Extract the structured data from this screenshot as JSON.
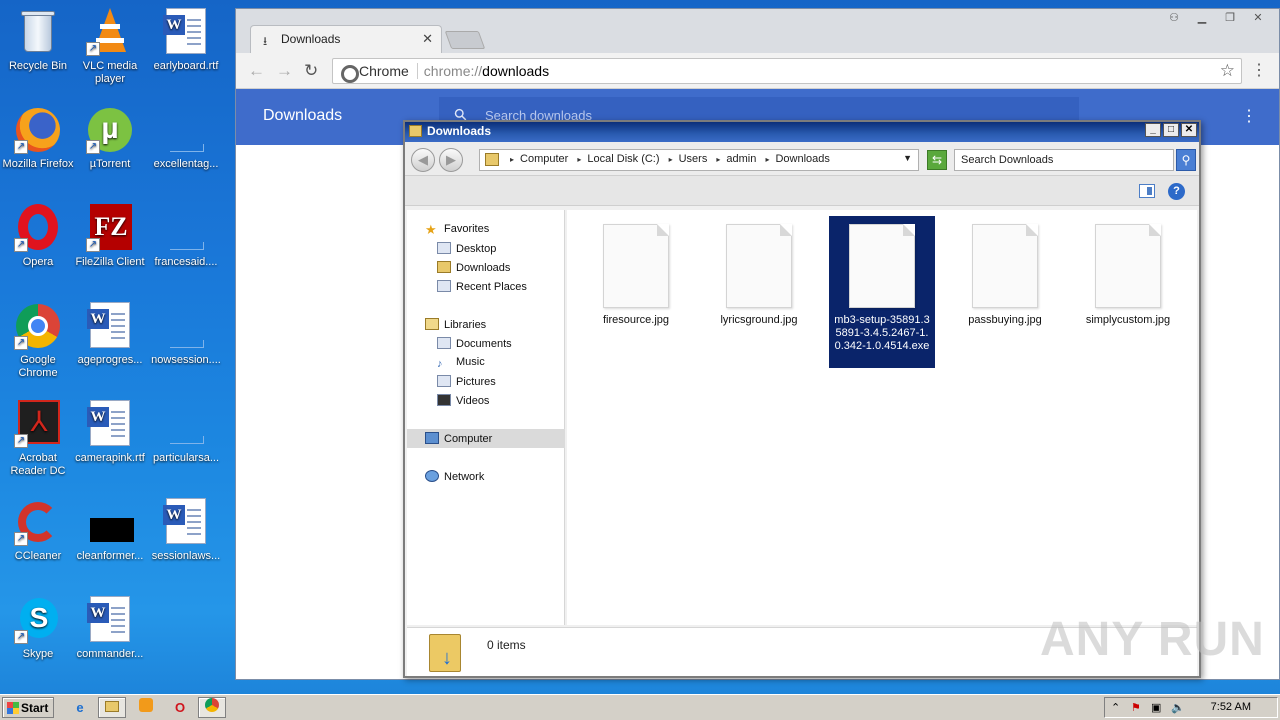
{
  "desktop": {
    "icons": [
      {
        "label": "Recycle Bin"
      },
      {
        "label": "VLC media player"
      },
      {
        "label": "earlyboard.rtf"
      },
      {
        "label": "Mozilla Firefox"
      },
      {
        "label": "µTorrent"
      },
      {
        "label": "excellentag..."
      },
      {
        "label": "Opera"
      },
      {
        "label": "FileZilla Client"
      },
      {
        "label": "francesaid...."
      },
      {
        "label": "Google Chrome"
      },
      {
        "label": "ageprogres..."
      },
      {
        "label": "nowsession...."
      },
      {
        "label": "Acrobat Reader DC"
      },
      {
        "label": "camerapink.rtf"
      },
      {
        "label": "particularsa..."
      },
      {
        "label": "CCleaner"
      },
      {
        "label": "cleanformer..."
      },
      {
        "label": "sessionlaws..."
      },
      {
        "label": "Skype"
      },
      {
        "label": "commander..."
      }
    ]
  },
  "chrome": {
    "tab_title": "Downloads",
    "omnibox_chip": "Chrome",
    "url_scheme": "chrome://",
    "url_path": "downloads",
    "page_title": "Downloads",
    "search_placeholder": "Search downloads"
  },
  "explorer": {
    "title": "Downloads",
    "breadcrumbs": [
      "Computer",
      "Local Disk (C:)",
      "Users",
      "admin",
      "Downloads"
    ],
    "search_placeholder": "Search Downloads",
    "nav": {
      "favorites": "Favorites",
      "desktop": "Desktop",
      "downloads": "Downloads",
      "recent": "Recent Places",
      "libraries": "Libraries",
      "documents": "Documents",
      "music": "Music",
      "pictures": "Pictures",
      "videos": "Videos",
      "computer": "Computer",
      "network": "Network"
    },
    "files": [
      {
        "name": "firesource.jpg"
      },
      {
        "name": "lyricsground.jpg"
      },
      {
        "name": "mb3-setup-35891.35891-3.4.5.2467-1.0.342-1.0.4514.exe",
        "selected": true
      },
      {
        "name": "passbuying.jpg"
      },
      {
        "name": "simplycustom.jpg"
      }
    ],
    "status_count": "0 items"
  },
  "taskbar": {
    "start_label": "Start",
    "clock": "7:52 AM"
  },
  "watermark": "ANY RUN",
  "colors": {
    "selection": "#0a246a",
    "chrome_header": "#3f6ccb",
    "desktop_blue": "#1a77d8"
  }
}
